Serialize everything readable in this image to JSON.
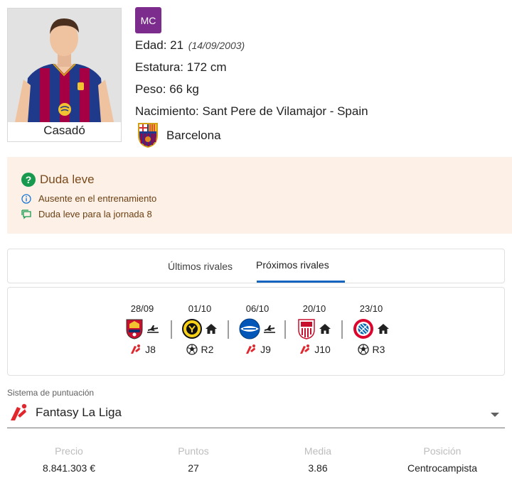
{
  "player": {
    "name": "Casadó",
    "position_badge": "MC",
    "age_label": "Edad: 21",
    "birth_date": "(14/09/2003)",
    "height_label": "Estatura: 172 cm",
    "weight_label": "Peso: 66 kg",
    "birthplace_label": "Nacimiento: Sant Pere de Vilamajor - Spain",
    "team": "Barcelona"
  },
  "status": {
    "title": "Duda leve",
    "lines": [
      {
        "icon": "info-icon",
        "text": "Ausente en el entrenamiento"
      },
      {
        "icon": "comment-icon",
        "text": "Duda leve para la jornada 8"
      }
    ],
    "colors": {
      "background": "#fdf0e6",
      "ok": "#179a4e"
    }
  },
  "tabs": [
    {
      "label": "Últimos rivales",
      "active": false
    },
    {
      "label": "Próximos rivales",
      "active": true
    }
  ],
  "fixtures": [
    {
      "date": "28/09",
      "opponent": "osasuna-crest",
      "venue": "away",
      "competition": "laliga",
      "round": "J8"
    },
    {
      "date": "01/10",
      "opponent": "young-boys-crest",
      "venue": "home",
      "competition": "champions",
      "round": "R2"
    },
    {
      "date": "06/10",
      "opponent": "alaves-crest",
      "venue": "away",
      "competition": "laliga",
      "round": "J9"
    },
    {
      "date": "20/10",
      "opponent": "sevilla-crest",
      "venue": "home",
      "competition": "laliga",
      "round": "J10"
    },
    {
      "date": "23/10",
      "opponent": "bayern-crest",
      "venue": "home",
      "competition": "champions",
      "round": "R3"
    }
  ],
  "scoring": {
    "label": "Sistema de puntuación",
    "value": "Fantasy La Liga"
  },
  "stats": [
    {
      "label": "Precio",
      "value": "8.841.303 €"
    },
    {
      "label": "Puntos",
      "value": "27"
    },
    {
      "label": "Media",
      "value": "3.86"
    },
    {
      "label": "Posición",
      "value": "Centrocampista"
    }
  ],
  "colors": {
    "badge": "#7b2c8c",
    "accent": "#1565c0",
    "laliga": "#e1262d"
  }
}
